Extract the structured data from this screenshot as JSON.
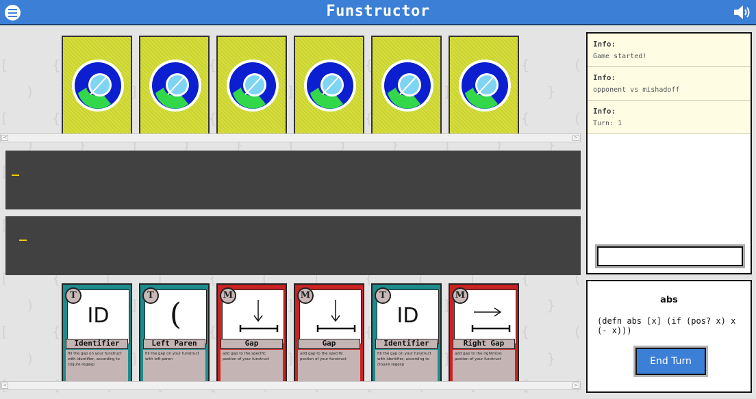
{
  "header": {
    "title": "Funstructor",
    "menu_icon": "hamburger-menu-icon",
    "sound_icon": "speaker-volume-icon"
  },
  "opponent_hand": {
    "card_count": 6,
    "card_back_icon": "clojure-logo-icon"
  },
  "boards": {
    "opponent_cursor": "_",
    "player_cursor": "_"
  },
  "player_hand": [
    {
      "type": "T",
      "art": "ID",
      "art_icon": "text",
      "name": "Identifier",
      "desc": "fill the gap on your funstruct with identifier, according to clojure regexp",
      "color": "teal"
    },
    {
      "type": "T",
      "art": "(",
      "art_icon": "text",
      "name": "Left Paren",
      "desc": "fill the gap on your funstruct with left paren",
      "color": "teal"
    },
    {
      "type": "M",
      "art": "",
      "art_icon": "down-arrow-gap-icon",
      "name": "Gap",
      "desc": "add gap to the specific postion of your funstruct",
      "color": "red"
    },
    {
      "type": "M",
      "art": "",
      "art_icon": "down-arrow-gap-icon",
      "name": "Gap",
      "desc": "add gap to the specific postion of your funstruct",
      "color": "red"
    },
    {
      "type": "T",
      "art": "ID",
      "art_icon": "text",
      "name": "Identifier",
      "desc": "fill the gap on your funstruct with identifier, according to clojure regexp",
      "color": "teal"
    },
    {
      "type": "M",
      "art": "",
      "art_icon": "right-arrow-gap-icon",
      "name": "Right Gap",
      "desc": "add gap to the rightmost postion of your funstruct",
      "color": "red"
    }
  ],
  "log": [
    {
      "label": "Info:",
      "message": "Game started!"
    },
    {
      "label": "Info:",
      "message": "opponent vs mishadoff"
    },
    {
      "label": "Info:",
      "message": "Turn: 1"
    }
  ],
  "chat": {
    "value": ""
  },
  "goal": {
    "name": "abs",
    "code": "(defn abs [x] (if (pos? x) x (- x)))",
    "end_turn_label": "End Turn"
  },
  "colors": {
    "header": "#3b7fd6",
    "card_back": "#d6df3a",
    "terminal_card": "#1e8c8c",
    "modifier_card": "#c92323",
    "board": "#414141",
    "cursor": "#f0d000"
  }
}
